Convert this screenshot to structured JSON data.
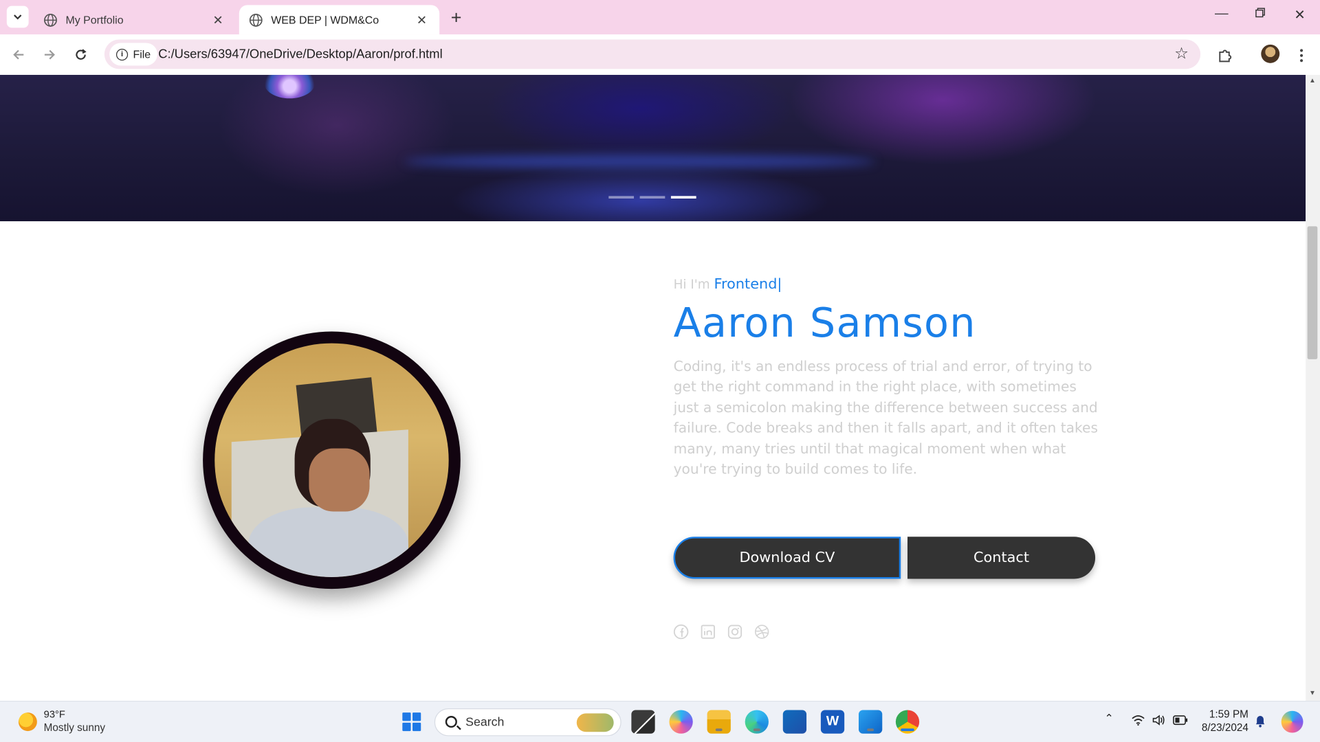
{
  "browser": {
    "tabs": [
      {
        "title": "My Portfolio",
        "active": false
      },
      {
        "title": "WEB DEP | WDM&Co",
        "active": true
      }
    ],
    "site_chip_label": "File",
    "url": "C:/Users/63947/OneDrive/Desktop/Aaron/prof.html"
  },
  "hero": {
    "slides_count": 3,
    "active_slide": 3
  },
  "profile": {
    "greeting_prefix": "Hi I'm",
    "typed_role": "Frontend",
    "typing_cursor": "|",
    "name": "Aaron Samson",
    "bio": "Coding, it's an endless process of trial and error, of trying to get the right command in the right place, with sometimes just a semicolon making the difference between success and failure. Code breaks and then it falls apart, and it often takes many, many tries until that magical moment when what you're trying to build comes to life.",
    "buttons": {
      "download_cv": "Download CV",
      "contact": "Contact"
    },
    "socials": [
      "facebook-icon",
      "linkedin-icon",
      "instagram-icon",
      "dribbble-icon"
    ],
    "accent_color": "#1a7fe8"
  },
  "taskbar": {
    "weather_temp": "93°F",
    "weather_desc": "Mostly sunny",
    "search_placeholder": "Search",
    "time": "1:59 PM",
    "date": "8/23/2024"
  }
}
